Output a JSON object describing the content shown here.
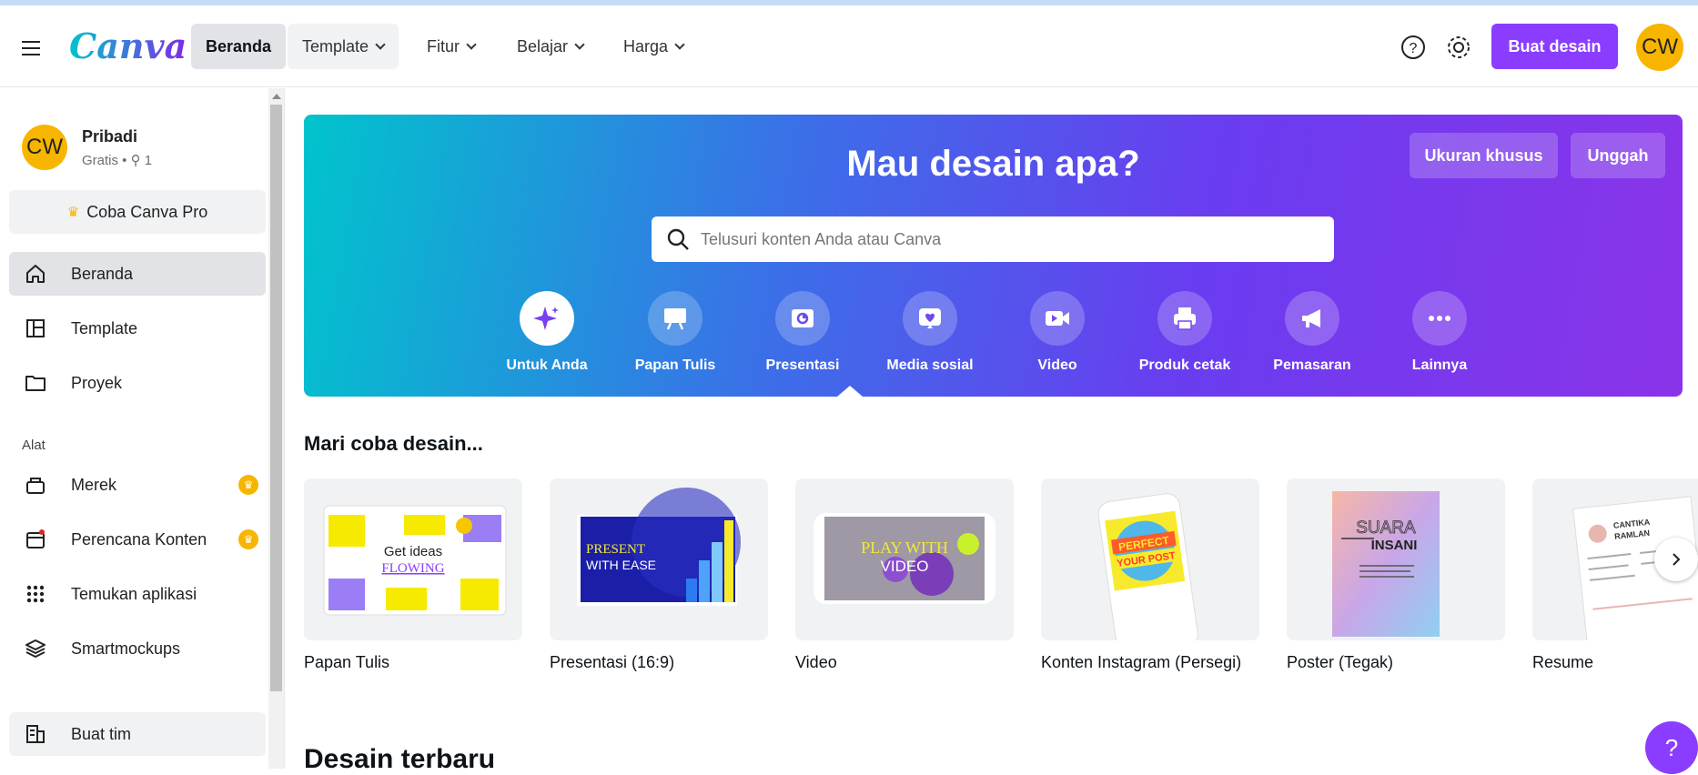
{
  "header": {
    "logo": "Canva",
    "nav": [
      {
        "label": "Beranda",
        "dropdown": false
      },
      {
        "label": "Template",
        "dropdown": true
      },
      {
        "label": "Fitur",
        "dropdown": true
      },
      {
        "label": "Belajar",
        "dropdown": true
      },
      {
        "label": "Harga",
        "dropdown": true
      }
    ],
    "create_button": "Buat desain",
    "avatar_initials": "CW",
    "icons": [
      "help-icon",
      "settings-icon"
    ]
  },
  "sidebar": {
    "team": {
      "initials": "CW",
      "name": "Pribadi",
      "plan": "Gratis • ⚲ 1"
    },
    "pro_button": "Coba Canva Pro",
    "items": [
      {
        "label": "Beranda",
        "icon": "home-icon"
      },
      {
        "label": "Template",
        "icon": "template-icon"
      },
      {
        "label": "Proyek",
        "icon": "folder-icon"
      }
    ],
    "section_label": "Alat",
    "tools": [
      {
        "label": "Merek",
        "icon": "brand-icon",
        "pro": true
      },
      {
        "label": "Perencana Konten",
        "icon": "calendar-icon",
        "pro": true
      },
      {
        "label": "Temukan aplikasi",
        "icon": "apps-grid-icon",
        "pro": false
      },
      {
        "label": "Smartmockups",
        "icon": "layers-icon",
        "pro": false
      }
    ],
    "team_button": "Buat tim"
  },
  "hero": {
    "title": "Mau desain apa?",
    "custom_size": "Ukuran khusus",
    "upload": "Unggah",
    "search_placeholder": "Telusuri konten Anda atau Canva",
    "categories": [
      {
        "label": "Untuk Anda",
        "icon": "sparkle-icon"
      },
      {
        "label": "Papan Tulis",
        "icon": "whiteboard-icon"
      },
      {
        "label": "Presentasi",
        "icon": "presentation-icon"
      },
      {
        "label": "Media sosial",
        "icon": "heart-icon"
      },
      {
        "label": "Video",
        "icon": "video-icon"
      },
      {
        "label": "Produk cetak",
        "icon": "printer-icon"
      },
      {
        "label": "Pemasaran",
        "icon": "megaphone-icon"
      },
      {
        "label": "Lainnya",
        "icon": "more-icon"
      }
    ]
  },
  "try_design": {
    "title": "Mari coba desain...",
    "cards": [
      {
        "label": "Papan Tulis",
        "thumb_text": [
          "Get ideas",
          "FLOWING"
        ]
      },
      {
        "label": "Presentasi (16:9)",
        "thumb_text": [
          "PRESENT",
          "WITH EASE"
        ]
      },
      {
        "label": "Video",
        "thumb_text": [
          "PLAY WITH",
          "VIDEO"
        ]
      },
      {
        "label": "Konten Instagram (Persegi)",
        "thumb_text": [
          "PERFECT",
          "YOUR POST"
        ]
      },
      {
        "label": "Poster (Tegak)",
        "thumb_text": [
          "SUARA",
          "INSANI"
        ]
      },
      {
        "label": "Resume",
        "thumb_text": [
          "CANTIKA",
          "RAMLAN"
        ]
      }
    ]
  },
  "recent": {
    "title": "Desain terbaru"
  },
  "help_fab": "?"
}
